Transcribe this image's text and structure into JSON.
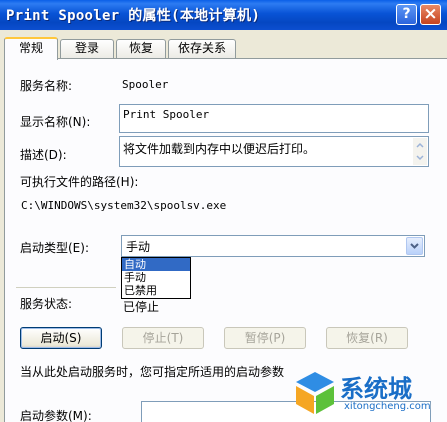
{
  "window": {
    "title": "Print Spooler 的属性(本地计算机)",
    "help_glyph": "?",
    "close_glyph": "×"
  },
  "tabs": [
    {
      "label": "常规",
      "active": true
    },
    {
      "label": "登录",
      "active": false
    },
    {
      "label": "恢复",
      "active": false
    },
    {
      "label": "依存关系",
      "active": false
    }
  ],
  "general": {
    "service_name_label": "服务名称:",
    "service_name_value": "Spooler",
    "display_name_label": "显示名称(N):",
    "display_name_value": "Print Spooler",
    "description_label": "描述(D):",
    "description_value": "将文件加载到内存中以便迟后打印。",
    "exe_path_label": "可执行文件的路径(H):",
    "exe_path_value": "C:\\WINDOWS\\system32\\spoolsv.exe",
    "startup_type_label": "启动类型(E):",
    "startup_type_value": "手动",
    "startup_options": [
      {
        "label": "自动",
        "selected": true
      },
      {
        "label": "手动",
        "selected": false
      },
      {
        "label": "已禁用",
        "selected": false
      }
    ],
    "service_status_label": "服务状态:",
    "service_status_value": "已停止",
    "buttons": {
      "start": "启动(S)",
      "stop": "停止(T)",
      "pause": "暂停(P)",
      "resume": "恢复(R)"
    },
    "hint_text": "当从此处启动服务时，您可指定所适用的启动参数",
    "start_params_label": "启动参数(M):"
  },
  "watermark": {
    "text": "系统城",
    "url": "xitongcheng.com"
  },
  "colors": {
    "title_bar": "#0853d6",
    "selection": "#316ac5",
    "tab_highlight": "#ffc73c",
    "watermark": "#1a6ec7"
  }
}
